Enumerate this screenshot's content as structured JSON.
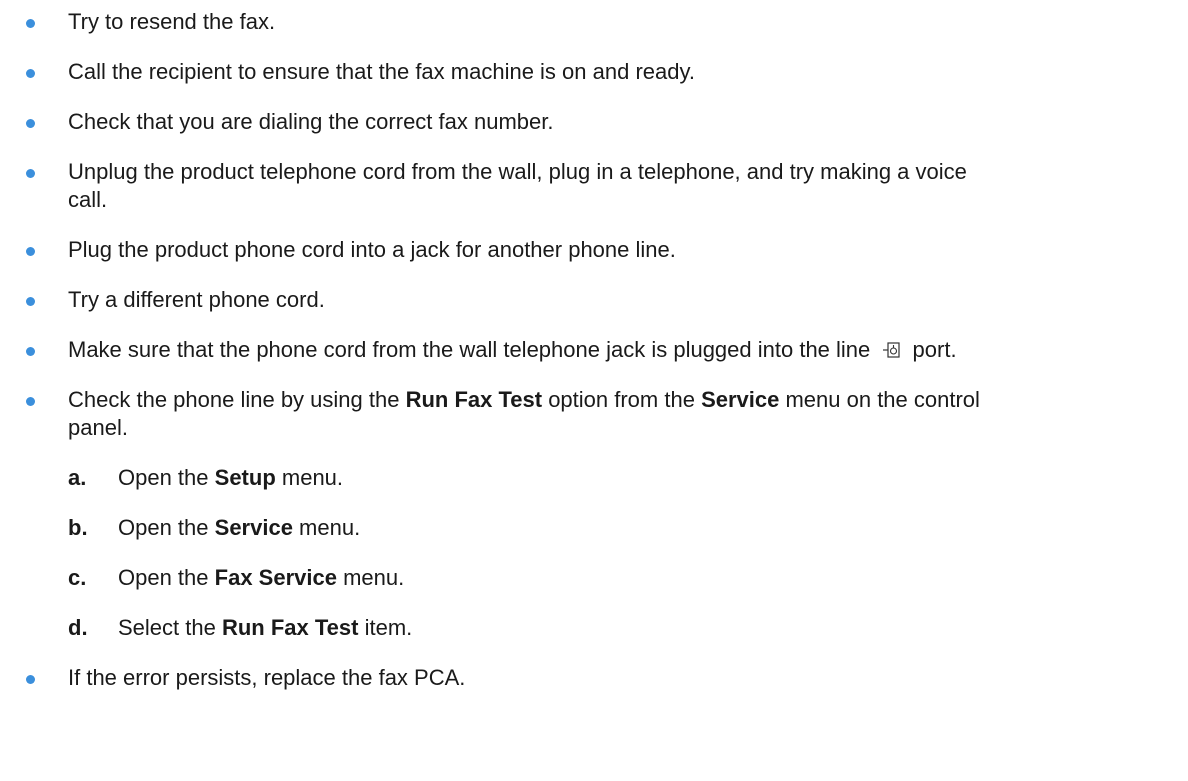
{
  "bullets": [
    {
      "text": "Try to resend the fax."
    },
    {
      "text": "Call the recipient to ensure that the fax machine is on and ready."
    },
    {
      "text": "Check that you are dialing the correct fax number."
    },
    {
      "line1": "Unplug the product telephone cord from the wall, plug in a telephone, and try making a voice",
      "line2": "call."
    },
    {
      "text": "Plug the product phone cord into a jack for another phone line."
    },
    {
      "text": "Try a different phone cord."
    },
    {
      "before": "Make sure that the phone cord from the wall telephone jack is plugged into the line",
      "icon": "line-port-icon",
      "after": "port."
    },
    {
      "pre": "Check the phone line by using the ",
      "bold1": "Run Fax Test",
      "mid": " option from the ",
      "bold2": "Service",
      "post": " menu on the control",
      "line2": "panel."
    },
    {
      "text": "If the error persists, replace the fax PCA."
    }
  ],
  "steps": [
    {
      "letter": "a.",
      "pre": "Open the ",
      "bold": "Setup",
      "post": " menu."
    },
    {
      "letter": "b.",
      "pre": "Open the ",
      "bold": "Service",
      "post": " menu."
    },
    {
      "letter": "c.",
      "pre": "Open the ",
      "bold": "Fax Service",
      "post": " menu."
    },
    {
      "letter": "d.",
      "pre": "Select the ",
      "bold": "Run Fax Test",
      "post": " item."
    }
  ],
  "colors": {
    "bullet": "#3b8fdc",
    "text": "#1a1a1a"
  }
}
